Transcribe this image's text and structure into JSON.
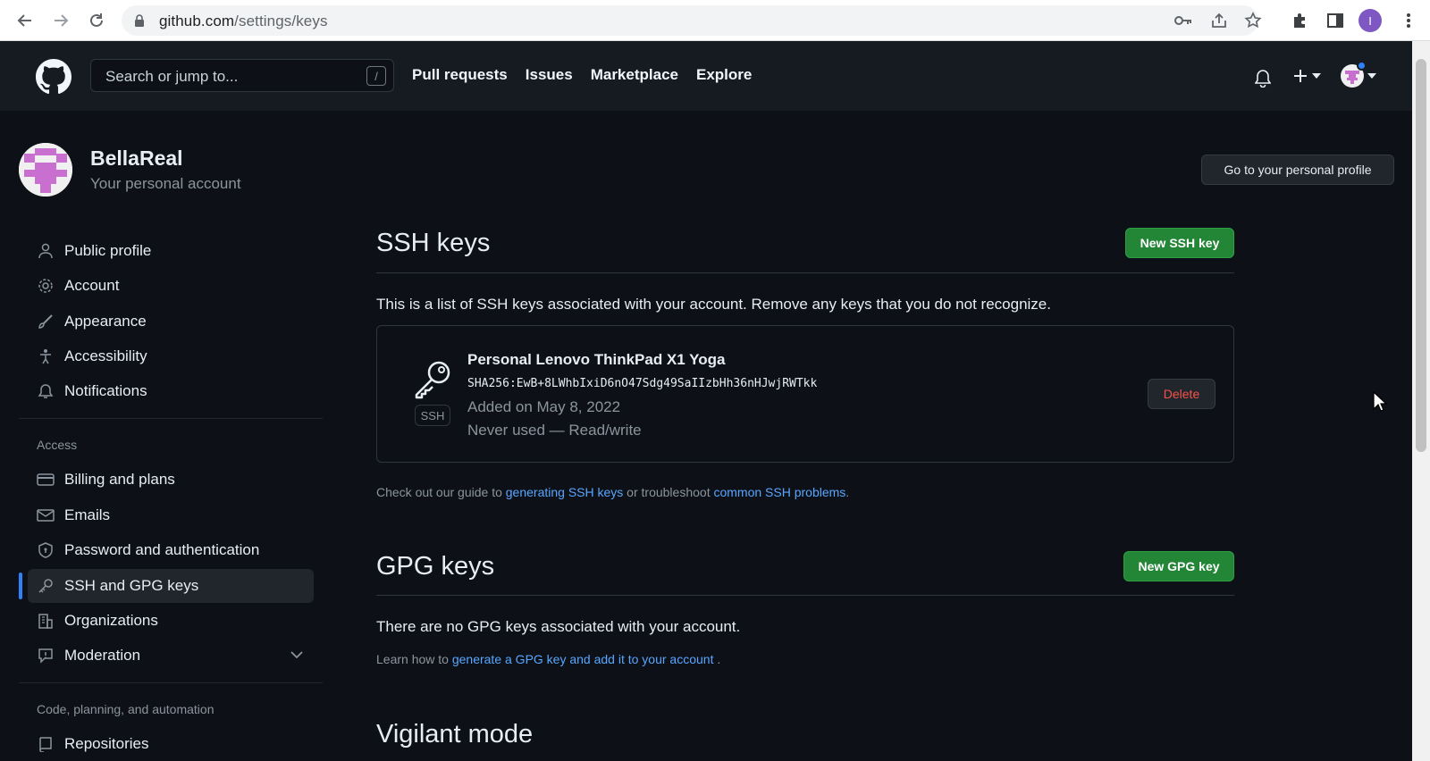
{
  "browser": {
    "url_host": "github.com",
    "url_path": "/settings/keys",
    "profile_initial": "I"
  },
  "header": {
    "search_placeholder": "Search or jump to...",
    "search_shortcut": "/",
    "nav": [
      "Pull requests",
      "Issues",
      "Marketplace",
      "Explore"
    ]
  },
  "user": {
    "name": "BellaReal",
    "subtitle": "Your personal account",
    "profile_button": "Go to your personal profile"
  },
  "sidebar": {
    "items": [
      {
        "label": "Public profile",
        "icon": "person-icon"
      },
      {
        "label": "Account",
        "icon": "gear-icon"
      },
      {
        "label": "Appearance",
        "icon": "paintbrush-icon"
      },
      {
        "label": "Accessibility",
        "icon": "accessibility-icon"
      },
      {
        "label": "Notifications",
        "icon": "bell-icon"
      }
    ],
    "access_heading": "Access",
    "access_items": [
      {
        "label": "Billing and plans",
        "icon": "credit-card-icon"
      },
      {
        "label": "Emails",
        "icon": "mail-icon"
      },
      {
        "label": "Password and authentication",
        "icon": "shield-icon"
      },
      {
        "label": "SSH and GPG keys",
        "icon": "key-icon"
      },
      {
        "label": "Organizations",
        "icon": "organization-icon"
      },
      {
        "label": "Moderation",
        "icon": "report-icon"
      }
    ],
    "code_heading": "Code, planning, and automation",
    "code_items": [
      {
        "label": "Repositories",
        "icon": "repo-icon"
      }
    ]
  },
  "ssh": {
    "title": "SSH keys",
    "new_button": "New SSH key",
    "description": "This is a list of SSH keys associated with your account. Remove any keys that you do not recognize.",
    "key": {
      "title": "Personal Lenovo ThinkPad X1 Yoga",
      "fingerprint": "SHA256:EwB+8LWhbIxiD6nO47Sdg49SaIIzbHh36nHJwjRWTkk",
      "added": "Added on May 8, 2022",
      "usage": "Never used — Read/write",
      "type_label": "SSH",
      "delete_button": "Delete"
    },
    "guide_prefix": "Check out our guide to ",
    "guide_link1": "generating SSH keys",
    "guide_middle": " or troubleshoot ",
    "guide_link2": "common SSH problems",
    "guide_suffix": "."
  },
  "gpg": {
    "title": "GPG keys",
    "new_button": "New GPG key",
    "description": "There are no GPG keys associated with your account.",
    "learn_prefix": "Learn how to ",
    "learn_link": "generate a GPG key and add it to your account",
    "learn_suffix": " ."
  },
  "vigilant": {
    "title": "Vigilant mode"
  },
  "colors": {
    "bg": "#0d1117",
    "header_bg": "#161b22",
    "accent_blue": "#2f81f7",
    "link": "#58a6ff",
    "green": "#238636",
    "danger": "#f85149"
  }
}
